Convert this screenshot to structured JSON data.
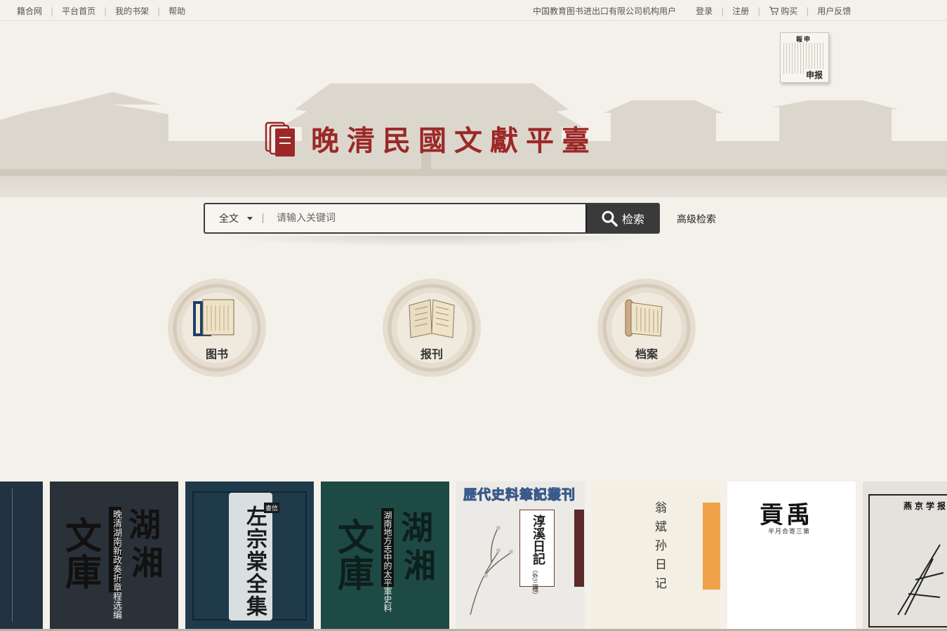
{
  "topbar": {
    "left_links": [
      "籍合网",
      "平台首页",
      "我的书架",
      "帮助"
    ],
    "right_links": {
      "institution": "中国教育图书进出口有限公司机构用户",
      "login": "登录",
      "register": "注册",
      "buy": "购买",
      "feedback": "用户反馈"
    }
  },
  "hero": {
    "title": "晚清民國文獻平臺",
    "shenbao_label": "申报",
    "shenbao_masthead": "報申"
  },
  "search": {
    "scope": "全文",
    "placeholder": "请输入关键词",
    "value": "",
    "button_label": "检索",
    "advanced_label": "高级检索"
  },
  "categories": [
    {
      "label": "图书",
      "icon": "book-scroll-icon"
    },
    {
      "label": "报刊",
      "icon": "open-newspaper-icon"
    },
    {
      "label": "档案",
      "icon": "archive-scroll-icon"
    }
  ],
  "books": [
    {
      "title_lines": [
        "湖",
        "湘",
        "文",
        "庫"
      ],
      "subtitle": "晚清湖南新政奏折章程选编",
      "bg": "#2b3138"
    },
    {
      "title": "左宗棠全集",
      "tag": "書信",
      "bg": "#1f3a4b"
    },
    {
      "title_lines": [
        "湖",
        "湘",
        "文",
        "庫"
      ],
      "subtitle": "湖南地方志中的太平軍史料",
      "bg": "#1e4a45"
    },
    {
      "series": "歷代史料筆記叢刊",
      "title": "淳溪日記",
      "subtitle": "（外三種）",
      "bg": "#eceae6"
    },
    {
      "title": "翁斌孙日记",
      "bg": "#f3efe3"
    },
    {
      "title": "貢禹",
      "subtitle": "半月合寄三第",
      "bg": "#ffffff"
    },
    {
      "title": "燕京学报",
      "bg": "#e4e2dc"
    }
  ],
  "colors": {
    "brand_red": "#9c2828",
    "search_button": "#3a3a3a",
    "page_bg": "#f4f1ea"
  }
}
